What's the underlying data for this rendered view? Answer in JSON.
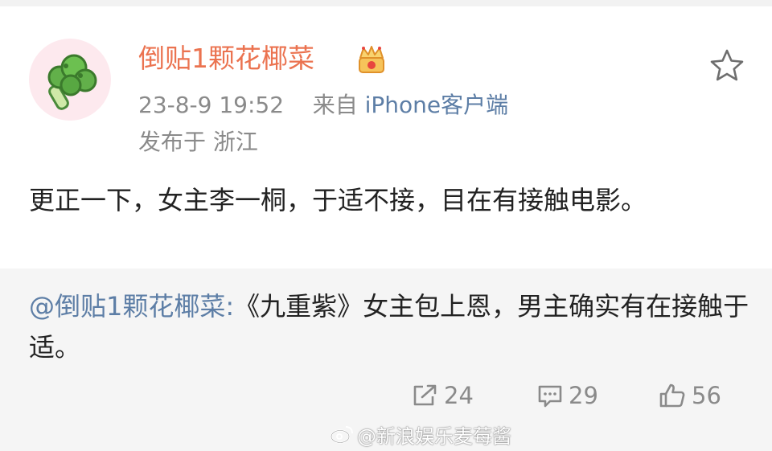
{
  "post": {
    "username": "倒贴1颗花椰菜",
    "time": "23-8-9 19:52",
    "source_prefix": "来自",
    "source": "iPhone客户端",
    "location": "发布于 浙江",
    "text": "更正一下，女主李一桐，于适不接，目在有接触电影。"
  },
  "quote": {
    "mention": "@倒贴1颗花椰菜:",
    "text": "《九重紫》女主包上恩，男主确实有在接触于适。"
  },
  "stats": {
    "reposts": "24",
    "comments": "29",
    "likes": "56"
  },
  "watermark": {
    "text": "@新浪娱乐麦莓酱"
  },
  "icons": {
    "avatar": "broccoli-avatar",
    "badge": "crown-vip-icon",
    "favorite": "star-icon",
    "repost": "repost-icon",
    "comment": "comment-icon",
    "like": "thumbs-up-icon"
  },
  "colors": {
    "username": "#eb7350",
    "link": "#5d7ea6",
    "meta": "#8a8a8a",
    "quote_bg": "#f5f5f5"
  }
}
